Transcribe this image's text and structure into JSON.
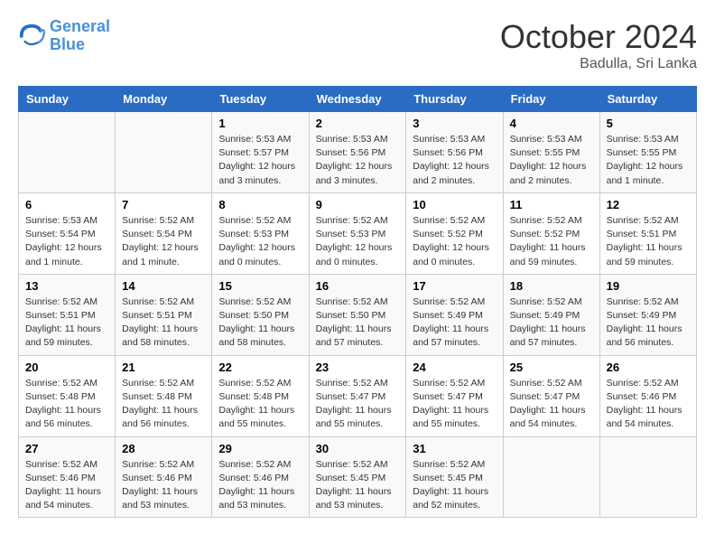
{
  "logo": {
    "line1": "General",
    "line2": "Blue"
  },
  "title": "October 2024",
  "location": "Badulla, Sri Lanka",
  "days_header": [
    "Sunday",
    "Monday",
    "Tuesday",
    "Wednesday",
    "Thursday",
    "Friday",
    "Saturday"
  ],
  "weeks": [
    [
      {
        "day": "",
        "info": ""
      },
      {
        "day": "",
        "info": ""
      },
      {
        "day": "1",
        "info": "Sunrise: 5:53 AM\nSunset: 5:57 PM\nDaylight: 12 hours\nand 3 minutes."
      },
      {
        "day": "2",
        "info": "Sunrise: 5:53 AM\nSunset: 5:56 PM\nDaylight: 12 hours\nand 3 minutes."
      },
      {
        "day": "3",
        "info": "Sunrise: 5:53 AM\nSunset: 5:56 PM\nDaylight: 12 hours\nand 2 minutes."
      },
      {
        "day": "4",
        "info": "Sunrise: 5:53 AM\nSunset: 5:55 PM\nDaylight: 12 hours\nand 2 minutes."
      },
      {
        "day": "5",
        "info": "Sunrise: 5:53 AM\nSunset: 5:55 PM\nDaylight: 12 hours\nand 1 minute."
      }
    ],
    [
      {
        "day": "6",
        "info": "Sunrise: 5:53 AM\nSunset: 5:54 PM\nDaylight: 12 hours\nand 1 minute."
      },
      {
        "day": "7",
        "info": "Sunrise: 5:52 AM\nSunset: 5:54 PM\nDaylight: 12 hours\nand 1 minute."
      },
      {
        "day": "8",
        "info": "Sunrise: 5:52 AM\nSunset: 5:53 PM\nDaylight: 12 hours\nand 0 minutes."
      },
      {
        "day": "9",
        "info": "Sunrise: 5:52 AM\nSunset: 5:53 PM\nDaylight: 12 hours\nand 0 minutes."
      },
      {
        "day": "10",
        "info": "Sunrise: 5:52 AM\nSunset: 5:52 PM\nDaylight: 12 hours\nand 0 minutes."
      },
      {
        "day": "11",
        "info": "Sunrise: 5:52 AM\nSunset: 5:52 PM\nDaylight: 11 hours\nand 59 minutes."
      },
      {
        "day": "12",
        "info": "Sunrise: 5:52 AM\nSunset: 5:51 PM\nDaylight: 11 hours\nand 59 minutes."
      }
    ],
    [
      {
        "day": "13",
        "info": "Sunrise: 5:52 AM\nSunset: 5:51 PM\nDaylight: 11 hours\nand 59 minutes."
      },
      {
        "day": "14",
        "info": "Sunrise: 5:52 AM\nSunset: 5:51 PM\nDaylight: 11 hours\nand 58 minutes."
      },
      {
        "day": "15",
        "info": "Sunrise: 5:52 AM\nSunset: 5:50 PM\nDaylight: 11 hours\nand 58 minutes."
      },
      {
        "day": "16",
        "info": "Sunrise: 5:52 AM\nSunset: 5:50 PM\nDaylight: 11 hours\nand 57 minutes."
      },
      {
        "day": "17",
        "info": "Sunrise: 5:52 AM\nSunset: 5:49 PM\nDaylight: 11 hours\nand 57 minutes."
      },
      {
        "day": "18",
        "info": "Sunrise: 5:52 AM\nSunset: 5:49 PM\nDaylight: 11 hours\nand 57 minutes."
      },
      {
        "day": "19",
        "info": "Sunrise: 5:52 AM\nSunset: 5:49 PM\nDaylight: 11 hours\nand 56 minutes."
      }
    ],
    [
      {
        "day": "20",
        "info": "Sunrise: 5:52 AM\nSunset: 5:48 PM\nDaylight: 11 hours\nand 56 minutes."
      },
      {
        "day": "21",
        "info": "Sunrise: 5:52 AM\nSunset: 5:48 PM\nDaylight: 11 hours\nand 56 minutes."
      },
      {
        "day": "22",
        "info": "Sunrise: 5:52 AM\nSunset: 5:48 PM\nDaylight: 11 hours\nand 55 minutes."
      },
      {
        "day": "23",
        "info": "Sunrise: 5:52 AM\nSunset: 5:47 PM\nDaylight: 11 hours\nand 55 minutes."
      },
      {
        "day": "24",
        "info": "Sunrise: 5:52 AM\nSunset: 5:47 PM\nDaylight: 11 hours\nand 55 minutes."
      },
      {
        "day": "25",
        "info": "Sunrise: 5:52 AM\nSunset: 5:47 PM\nDaylight: 11 hours\nand 54 minutes."
      },
      {
        "day": "26",
        "info": "Sunrise: 5:52 AM\nSunset: 5:46 PM\nDaylight: 11 hours\nand 54 minutes."
      }
    ],
    [
      {
        "day": "27",
        "info": "Sunrise: 5:52 AM\nSunset: 5:46 PM\nDaylight: 11 hours\nand 54 minutes."
      },
      {
        "day": "28",
        "info": "Sunrise: 5:52 AM\nSunset: 5:46 PM\nDaylight: 11 hours\nand 53 minutes."
      },
      {
        "day": "29",
        "info": "Sunrise: 5:52 AM\nSunset: 5:46 PM\nDaylight: 11 hours\nand 53 minutes."
      },
      {
        "day": "30",
        "info": "Sunrise: 5:52 AM\nSunset: 5:45 PM\nDaylight: 11 hours\nand 53 minutes."
      },
      {
        "day": "31",
        "info": "Sunrise: 5:52 AM\nSunset: 5:45 PM\nDaylight: 11 hours\nand 52 minutes."
      },
      {
        "day": "",
        "info": ""
      },
      {
        "day": "",
        "info": ""
      }
    ]
  ]
}
